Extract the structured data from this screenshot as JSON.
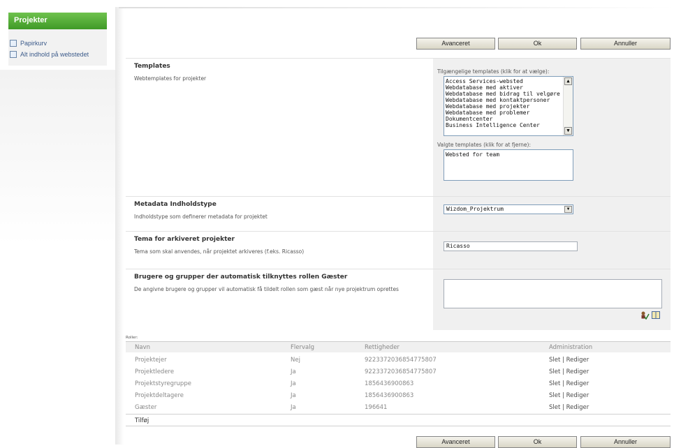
{
  "sidebar": {
    "header": "Projekter",
    "links": [
      {
        "label": "Papirkurv",
        "icon": "recycle-bin-icon"
      },
      {
        "label": "Alt indhold på webstedet",
        "icon": "site-content-icon"
      }
    ]
  },
  "toolbar": {
    "advanced_label": "Avanceret",
    "ok_label": "Ok",
    "cancel_label": "Annuller"
  },
  "templates": {
    "title": "Templates",
    "description": "Webtemplates for projekter",
    "available_label": "Tilgængelige templates (klik for at vælge):",
    "available": [
      "Access Services-websted",
      "Webdatabase med aktiver",
      "Webdatabase med bidrag til velgøre",
      "Webdatabase med kontaktpersoner",
      "Webdatabase med projekter",
      "Webdatabase med problemer",
      "Dokumentcenter",
      "Business Intelligence Center"
    ],
    "selected_label": "Valgte templates (klik for at fjerne):",
    "selected": [
      "Websted for team"
    ]
  },
  "metadata": {
    "title": "Metadata Indholdstype",
    "description": "Indholdstype som definerer metadata for projektet",
    "value": "Wizdom_Projektrum"
  },
  "theme": {
    "title": "Tema for arkiveret projekter",
    "description": "Tema som skal anvendes, når projektet arkiveres (f.eks. Ricasso)",
    "value": "Ricasso"
  },
  "guests": {
    "title": "Brugere og grupper der automatisk tilknyttes rollen Gæster",
    "description": "De angivne brugere og grupper vil automatisk få tildelt rollen som gæst når nye projektrum oprettes"
  },
  "roles": {
    "label": "Roller:",
    "headers": [
      "Navn",
      "Flervalg",
      "Rettigheder",
      "Administration"
    ],
    "rows": [
      {
        "name": "Projektejer",
        "multi": "Nej",
        "rights": "9223372036854775807",
        "admin": "Slet | Rediger"
      },
      {
        "name": "Projektledere",
        "multi": "Ja",
        "rights": "9223372036854775807",
        "admin": "Slet | Rediger"
      },
      {
        "name": "Projektstyregruppe",
        "multi": "Ja",
        "rights": "1856436900863",
        "admin": "Slet | Rediger"
      },
      {
        "name": "Projektdeltagere",
        "multi": "Ja",
        "rights": "1856436900863",
        "admin": "Slet | Rediger"
      },
      {
        "name": "Gæster",
        "multi": "Ja",
        "rights": "196641",
        "admin": "Slet | Rediger"
      }
    ],
    "add_label": "Tilføj"
  }
}
